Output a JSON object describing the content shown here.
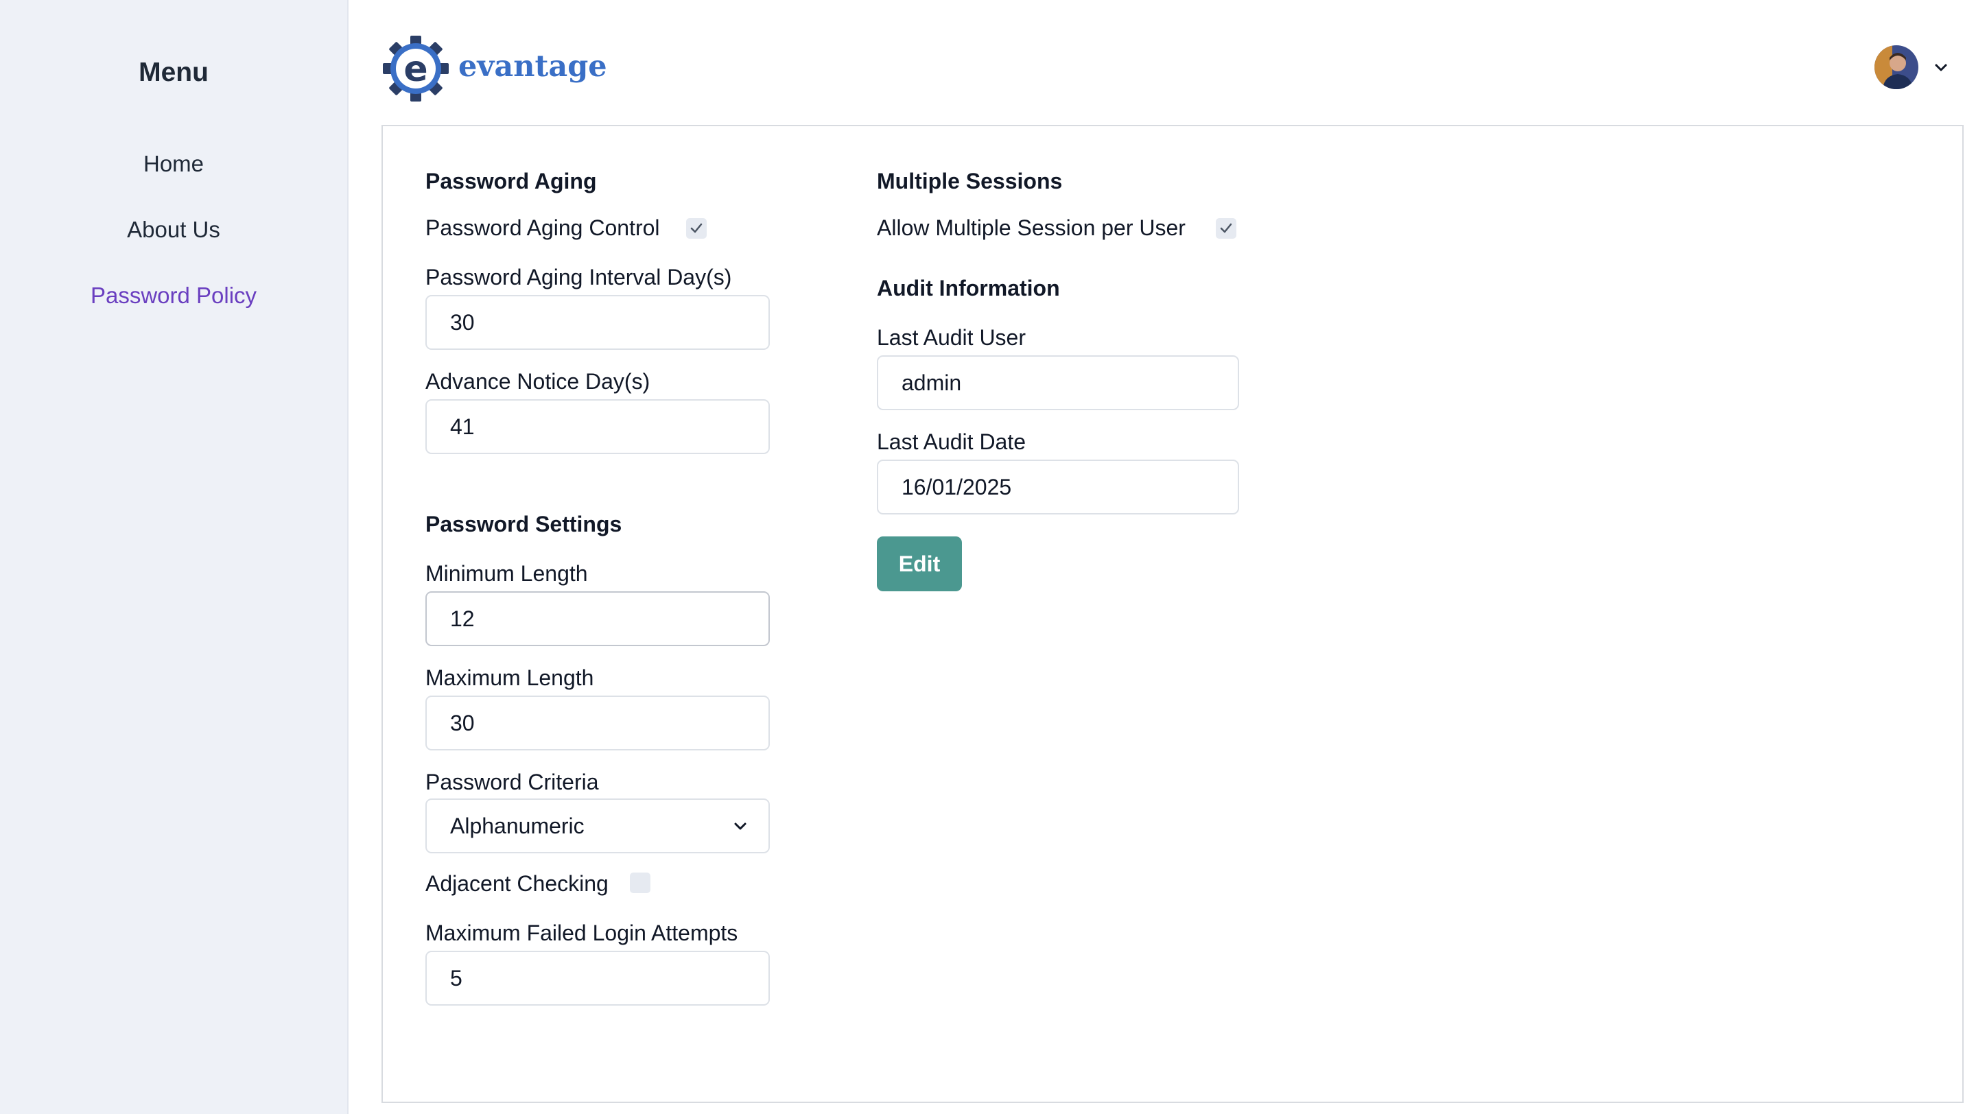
{
  "brand": {
    "name": "evantage",
    "logo_icon": "gear-e-logo-icon"
  },
  "sidebar": {
    "title": "Menu",
    "items": [
      {
        "label": "Home",
        "active": false
      },
      {
        "label": "About Us",
        "active": false
      },
      {
        "label": "Password Policy",
        "active": true
      }
    ]
  },
  "header": {
    "avatar_icon": "user-avatar",
    "menu_icon": "chevron-down-icon"
  },
  "password_aging": {
    "title": "Password Aging",
    "control_label": "Password Aging Control",
    "control_checked": true,
    "interval_label": "Password Aging Interval Day(s)",
    "interval_value": "30",
    "notice_label": "Advance Notice Day(s)",
    "notice_value": "41"
  },
  "password_settings": {
    "title": "Password Settings",
    "min_length_label": "Minimum Length",
    "min_length_value": "12",
    "max_length_label": "Maximum Length",
    "max_length_value": "30",
    "criteria_label": "Password Criteria",
    "criteria_value": "Alphanumeric",
    "adjacent_label": "Adjacent Checking",
    "adjacent_checked": false,
    "max_failed_label": "Maximum Failed Login Attempts",
    "max_failed_value": "5"
  },
  "multiple_sessions": {
    "title": "Multiple Sessions",
    "allow_label": "Allow Multiple Session per User",
    "allow_checked": true
  },
  "audit": {
    "title": "Audit Information",
    "user_label": "Last Audit User",
    "user_value": "admin",
    "date_label": "Last Audit Date",
    "date_value": "16/01/2025"
  },
  "actions": {
    "edit_label": "Edit"
  },
  "colors": {
    "sidebar_bg": "#eef1f7",
    "active_link": "#6a3fc0",
    "primary_button": "#4b9890",
    "logo_blue": "#3a6fc6",
    "logo_dark": "#2b3e66"
  }
}
